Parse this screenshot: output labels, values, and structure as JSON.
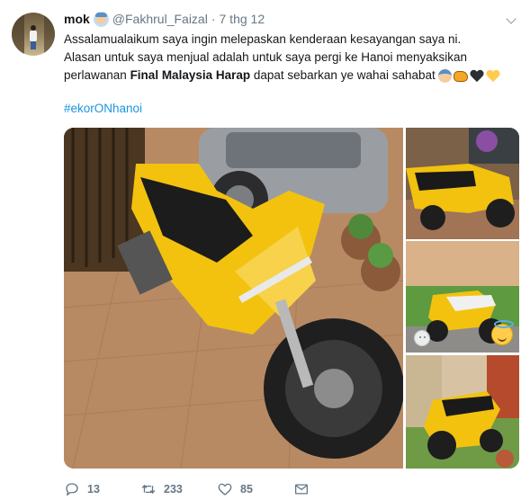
{
  "tweet": {
    "display_name": "mok",
    "handle": "@Fakhrul_Faizal",
    "separator": "·",
    "date": "7 thg 12",
    "text_line1": "Assalamualaikum saya ingin melepaskan kenderaan kesayangan saya ni.",
    "text_line2": "Alasan untuk saya menjual adalah untuk saya pergi ke Hanoi menyaksikan",
    "text_line3_before": "perlawanan ",
    "text_line3_bold": "Final Malaysia Harap",
    "text_line3_after": " dapat sebarkan ye wahai sahabat",
    "hashtag": "#ekorONhanoi",
    "end_emojis": [
      "mechanic-emoji",
      "tiger-emoji",
      "black-heart-emoji",
      "yellow-heart-emoji"
    ]
  },
  "photos": [
    {
      "name": "photo-main",
      "description_icon": "motorcycle-yellow-side"
    },
    {
      "name": "photo-1",
      "description_icon": "motorcycle-yellow-rear"
    },
    {
      "name": "photo-2",
      "description_icon": "motorcycle-yellow-yard"
    },
    {
      "name": "photo-3",
      "description_icon": "motorcycle-yellow-front"
    }
  ],
  "actions": {
    "reply_count": "13",
    "retweet_count": "233",
    "like_count": "85"
  },
  "colors": {
    "link": "#1b95e0",
    "secondary_text": "#657786",
    "primary_text": "#14171a",
    "bike_yellow": "#f2c20f"
  },
  "icons": {
    "reply": "reply-icon",
    "retweet": "retweet-icon",
    "like": "heart-icon",
    "message": "envelope-icon",
    "more": "chevron-down-icon"
  }
}
